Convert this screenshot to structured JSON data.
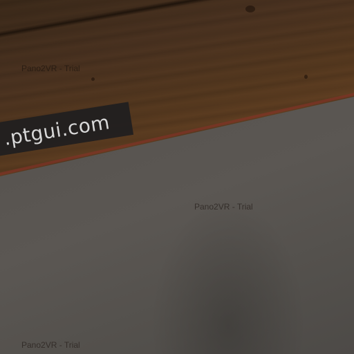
{
  "banner": {
    "text": ".ptgui.com"
  },
  "watermarks": [
    "Pano2VR - Trial",
    "Pano2VR - Trial",
    "Pano2VR - Trial"
  ]
}
